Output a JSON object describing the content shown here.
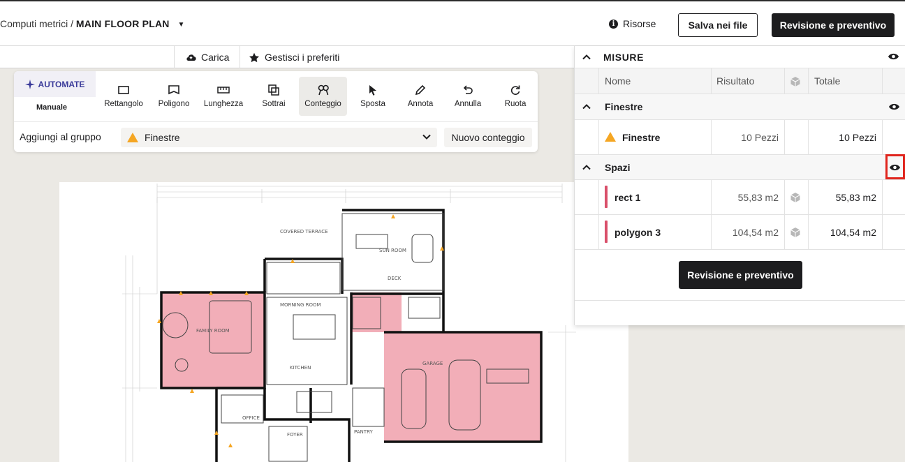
{
  "header": {
    "breadcrumb_root": "Computi metrici /",
    "breadcrumb_current": "MAIN FLOOR PLAN",
    "risorse_label": "Risorse",
    "save_label": "Salva nei file",
    "review_label": "Revisione e preventivo"
  },
  "subbar": {
    "carica_label": "Carica",
    "preferiti_label": "Gestisci i preferiti"
  },
  "toolbar": {
    "automate_label": "AUTOMATE",
    "manuale_label": "Manuale",
    "tools": [
      {
        "label": "Rettangolo",
        "icon": "rectangle-icon"
      },
      {
        "label": "Poligono",
        "icon": "polygon-icon"
      },
      {
        "label": "Lunghezza",
        "icon": "ruler-icon"
      },
      {
        "label": "Sottrai",
        "icon": "subtract-icon"
      },
      {
        "label": "Conteggio",
        "icon": "count-icon",
        "active": true
      },
      {
        "label": "Sposta",
        "icon": "cursor-icon"
      },
      {
        "label": "Annota",
        "icon": "pen-icon"
      },
      {
        "label": "Annulla",
        "icon": "undo-icon"
      },
      {
        "label": "Ruota",
        "icon": "rotate-icon"
      }
    ],
    "group_label": "Aggiungi al gruppo",
    "group_value": "Finestre",
    "new_count_label": "Nuovo conteggio"
  },
  "plan": {
    "rooms": [
      "SUN ROOM",
      "MORNING ROOM",
      "FAMILY ROOM",
      "KITCHEN",
      "GARAGE",
      "OFFICE",
      "FOYER",
      "PANTRY",
      "COVERED TERRACE",
      "DECK"
    ]
  },
  "panel": {
    "section_title": "MISURE",
    "columns": [
      "Nome",
      "Risultato",
      "Totale"
    ],
    "groups": [
      {
        "name": "Finestre",
        "items": [
          {
            "name": "Finestre",
            "result": "10 Pezzi",
            "total": "10 Pezzi"
          }
        ]
      },
      {
        "name": "Spazi",
        "items": [
          {
            "name": "rect 1",
            "result": "55,83 m2",
            "total": "55,83 m2"
          },
          {
            "name": "polygon 3",
            "result": "104,54 m2",
            "total": "104,54 m2"
          }
        ]
      }
    ],
    "review_label": "Revisione e preventivo"
  },
  "colors": {
    "accent_dark": "#1d1d1f",
    "highlight_red": "#e0241c",
    "area_pink": "#f0a0ac",
    "marker_orange": "#f5a623"
  }
}
